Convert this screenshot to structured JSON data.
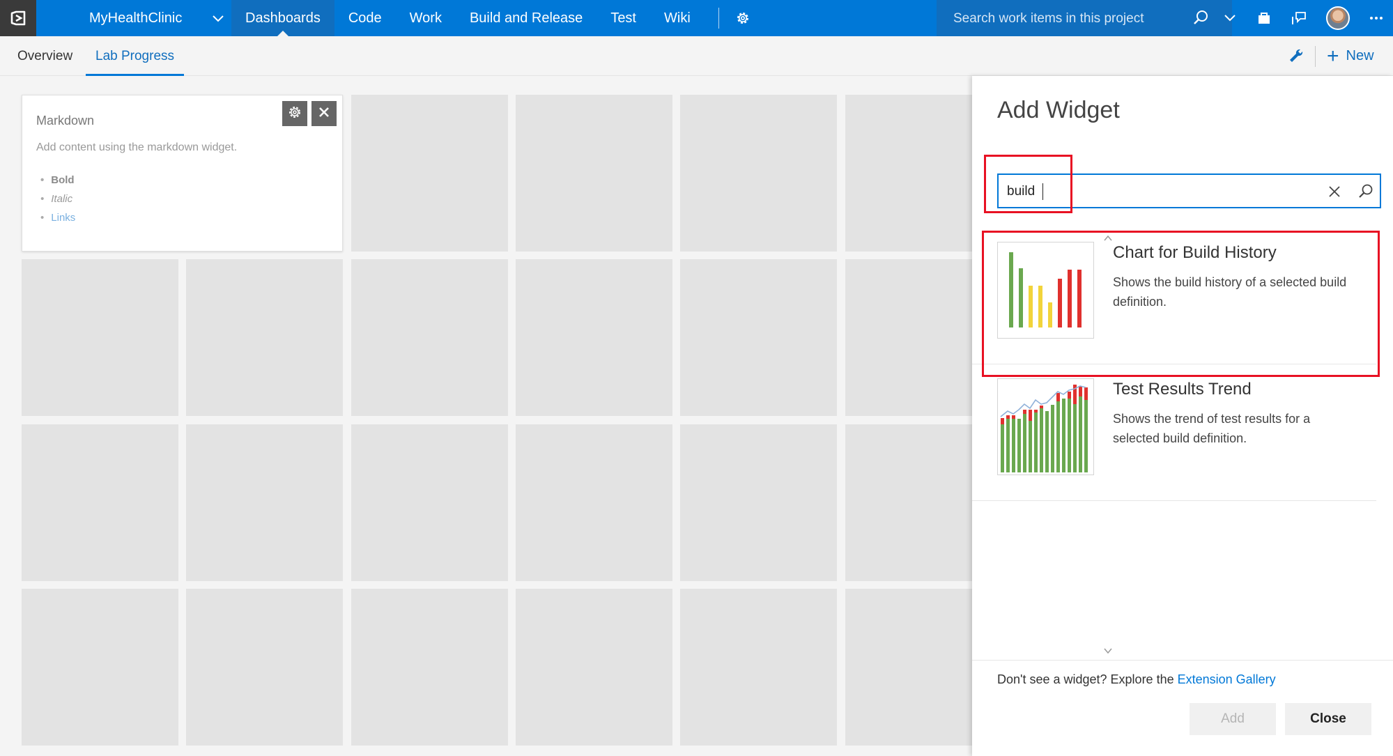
{
  "topbar": {
    "project_name": "MyHealthClinic",
    "nav_items": [
      "Dashboards",
      "Code",
      "Work",
      "Build and Release",
      "Test",
      "Wiki"
    ],
    "active_nav": "Dashboards",
    "search_placeholder": "Search work items in this project",
    "icons": [
      "vsts-logo-icon",
      "chevron-down-icon",
      "gear-icon",
      "search-icon",
      "chevron-down-icon",
      "marketplace-bag-icon",
      "feedback-icon",
      "avatar",
      "more-ellipsis-icon"
    ]
  },
  "subbar": {
    "tabs": [
      "Overview",
      "Lab Progress"
    ],
    "active_tab": "Lab Progress",
    "new_label": "New"
  },
  "markdown_widget": {
    "title": "Markdown",
    "description": "Add content using the markdown widget.",
    "bold": "Bold",
    "italic": "Italic",
    "link": "Links"
  },
  "panel": {
    "title": "Add Widget",
    "search_value": "build",
    "results": [
      {
        "title": "Chart for Build History",
        "description": "Shows the build history of a selected build definition.",
        "icon": "build-history-chart-thumbnail"
      },
      {
        "title": "Test Results Trend",
        "description": "Shows the trend of test results for a selected build definition.",
        "icon": "test-results-trend-thumbnail"
      }
    ],
    "footer_text": "Don't see a widget? Explore the ",
    "footer_link": "Extension Gallery",
    "add_label": "Add",
    "close_label": "Close"
  },
  "colors": {
    "topbar": "#0078d7",
    "topbar_active": "#106ebe",
    "highlight": "#e81123",
    "build_success": "#6aa84f",
    "build_partial": "#f2d43b",
    "build_failed": "#e0312e"
  }
}
